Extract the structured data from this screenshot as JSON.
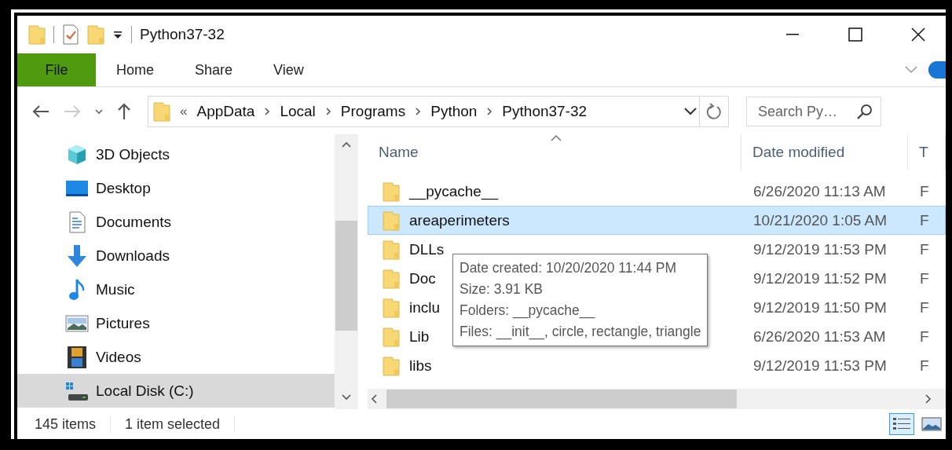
{
  "window": {
    "title": "Python37-32"
  },
  "ribbon": {
    "file_tab": "File",
    "tabs": [
      {
        "label": "Home"
      },
      {
        "label": "Share"
      },
      {
        "label": "View"
      }
    ]
  },
  "address": {
    "overflow_mark": "«",
    "crumbs": [
      "AppData",
      "Local",
      "Programs",
      "Python",
      "Python37-32"
    ]
  },
  "search": {
    "placeholder": "Search Py…"
  },
  "sidebar": {
    "items": [
      {
        "kind": "cube",
        "label": "3D Objects",
        "selected": false
      },
      {
        "kind": "desktop",
        "label": "Desktop",
        "selected": false
      },
      {
        "kind": "documents",
        "label": "Documents",
        "selected": false
      },
      {
        "kind": "downloads",
        "label": "Downloads",
        "selected": false
      },
      {
        "kind": "music",
        "label": "Music",
        "selected": false
      },
      {
        "kind": "pictures",
        "label": "Pictures",
        "selected": false
      },
      {
        "kind": "videos",
        "label": "Videos",
        "selected": false
      },
      {
        "kind": "disk",
        "label": "Local Disk (C:)",
        "selected": true
      }
    ]
  },
  "table": {
    "columns": [
      "Name",
      "Date modified",
      "T"
    ],
    "rows": [
      {
        "name": "__pycache__",
        "date": "6/26/2020 11:13 AM",
        "column_3": "F",
        "selected": false
      },
      {
        "name": "areaperimeters",
        "date": "10/21/2020 1:05 AM",
        "column_3": "F",
        "selected": true
      },
      {
        "name": "DLLs",
        "date": "9/12/2019 11:53 PM",
        "column_3": "F",
        "selected": false
      },
      {
        "name": "Doc",
        "date": "9/12/2019 11:52 PM",
        "column_3": "F",
        "selected": false
      },
      {
        "name": "inclu",
        "date": "9/12/2019 11:50 PM",
        "column_3": "F",
        "selected": false
      },
      {
        "name": "Lib",
        "date": "6/26/2020 11:53 AM",
        "column_3": "F",
        "selected": false
      },
      {
        "name": "libs",
        "date": "9/12/2019 11:53 PM",
        "column_3": "F",
        "selected": false
      }
    ]
  },
  "tooltip": {
    "lines": [
      "Date created: 10/20/2020 11:44 PM",
      "Size: 3.91 KB",
      "Folders: __pycache__",
      "Files: __init__, circle, rectangle, triangle"
    ]
  },
  "status_bar": {
    "count": "145 items",
    "selection": "1 item selected"
  },
  "view_buttons": [
    {
      "kind": "details",
      "selected": true
    },
    {
      "kind": "large",
      "selected": false
    }
  ]
}
